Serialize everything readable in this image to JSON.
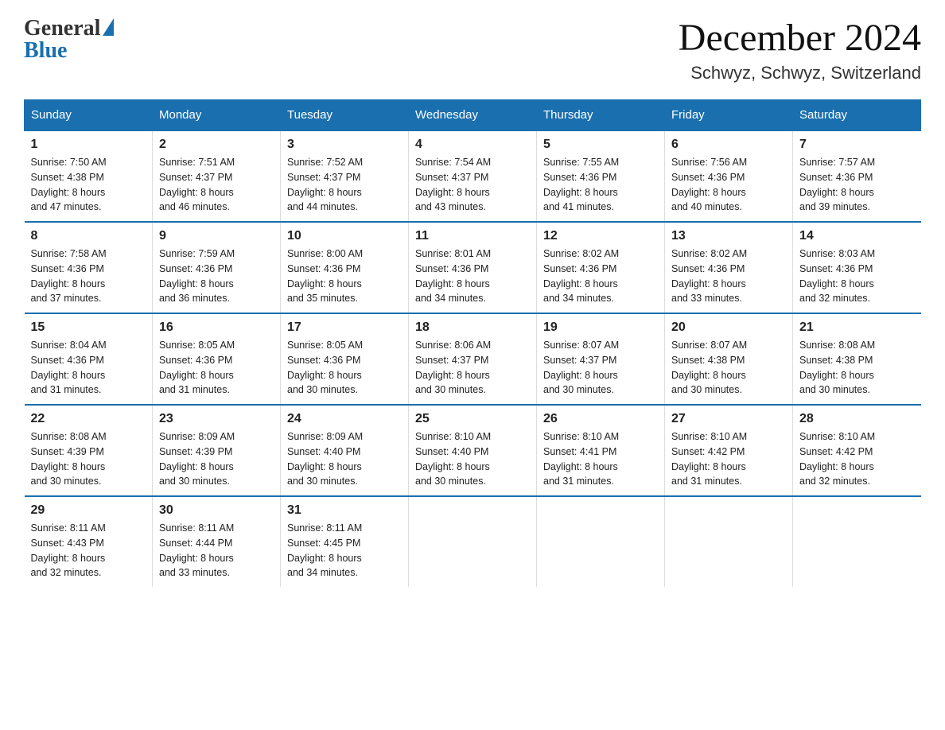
{
  "header": {
    "logo_general": "General",
    "logo_blue": "Blue",
    "month_title": "December 2024",
    "location": "Schwyz, Schwyz, Switzerland"
  },
  "days_of_week": [
    "Sunday",
    "Monday",
    "Tuesday",
    "Wednesday",
    "Thursday",
    "Friday",
    "Saturday"
  ],
  "weeks": [
    [
      {
        "day": "1",
        "sunrise": "7:50 AM",
        "sunset": "4:38 PM",
        "daylight": "8 hours and 47 minutes."
      },
      {
        "day": "2",
        "sunrise": "7:51 AM",
        "sunset": "4:37 PM",
        "daylight": "8 hours and 46 minutes."
      },
      {
        "day": "3",
        "sunrise": "7:52 AM",
        "sunset": "4:37 PM",
        "daylight": "8 hours and 44 minutes."
      },
      {
        "day": "4",
        "sunrise": "7:54 AM",
        "sunset": "4:37 PM",
        "daylight": "8 hours and 43 minutes."
      },
      {
        "day": "5",
        "sunrise": "7:55 AM",
        "sunset": "4:36 PM",
        "daylight": "8 hours and 41 minutes."
      },
      {
        "day": "6",
        "sunrise": "7:56 AM",
        "sunset": "4:36 PM",
        "daylight": "8 hours and 40 minutes."
      },
      {
        "day": "7",
        "sunrise": "7:57 AM",
        "sunset": "4:36 PM",
        "daylight": "8 hours and 39 minutes."
      }
    ],
    [
      {
        "day": "8",
        "sunrise": "7:58 AM",
        "sunset": "4:36 PM",
        "daylight": "8 hours and 37 minutes."
      },
      {
        "day": "9",
        "sunrise": "7:59 AM",
        "sunset": "4:36 PM",
        "daylight": "8 hours and 36 minutes."
      },
      {
        "day": "10",
        "sunrise": "8:00 AM",
        "sunset": "4:36 PM",
        "daylight": "8 hours and 35 minutes."
      },
      {
        "day": "11",
        "sunrise": "8:01 AM",
        "sunset": "4:36 PM",
        "daylight": "8 hours and 34 minutes."
      },
      {
        "day": "12",
        "sunrise": "8:02 AM",
        "sunset": "4:36 PM",
        "daylight": "8 hours and 34 minutes."
      },
      {
        "day": "13",
        "sunrise": "8:02 AM",
        "sunset": "4:36 PM",
        "daylight": "8 hours and 33 minutes."
      },
      {
        "day": "14",
        "sunrise": "8:03 AM",
        "sunset": "4:36 PM",
        "daylight": "8 hours and 32 minutes."
      }
    ],
    [
      {
        "day": "15",
        "sunrise": "8:04 AM",
        "sunset": "4:36 PM",
        "daylight": "8 hours and 31 minutes."
      },
      {
        "day": "16",
        "sunrise": "8:05 AM",
        "sunset": "4:36 PM",
        "daylight": "8 hours and 31 minutes."
      },
      {
        "day": "17",
        "sunrise": "8:05 AM",
        "sunset": "4:36 PM",
        "daylight": "8 hours and 30 minutes."
      },
      {
        "day": "18",
        "sunrise": "8:06 AM",
        "sunset": "4:37 PM",
        "daylight": "8 hours and 30 minutes."
      },
      {
        "day": "19",
        "sunrise": "8:07 AM",
        "sunset": "4:37 PM",
        "daylight": "8 hours and 30 minutes."
      },
      {
        "day": "20",
        "sunrise": "8:07 AM",
        "sunset": "4:38 PM",
        "daylight": "8 hours and 30 minutes."
      },
      {
        "day": "21",
        "sunrise": "8:08 AM",
        "sunset": "4:38 PM",
        "daylight": "8 hours and 30 minutes."
      }
    ],
    [
      {
        "day": "22",
        "sunrise": "8:08 AM",
        "sunset": "4:39 PM",
        "daylight": "8 hours and 30 minutes."
      },
      {
        "day": "23",
        "sunrise": "8:09 AM",
        "sunset": "4:39 PM",
        "daylight": "8 hours and 30 minutes."
      },
      {
        "day": "24",
        "sunrise": "8:09 AM",
        "sunset": "4:40 PM",
        "daylight": "8 hours and 30 minutes."
      },
      {
        "day": "25",
        "sunrise": "8:10 AM",
        "sunset": "4:40 PM",
        "daylight": "8 hours and 30 minutes."
      },
      {
        "day": "26",
        "sunrise": "8:10 AM",
        "sunset": "4:41 PM",
        "daylight": "8 hours and 31 minutes."
      },
      {
        "day": "27",
        "sunrise": "8:10 AM",
        "sunset": "4:42 PM",
        "daylight": "8 hours and 31 minutes."
      },
      {
        "day": "28",
        "sunrise": "8:10 AM",
        "sunset": "4:42 PM",
        "daylight": "8 hours and 32 minutes."
      }
    ],
    [
      {
        "day": "29",
        "sunrise": "8:11 AM",
        "sunset": "4:43 PM",
        "daylight": "8 hours and 32 minutes."
      },
      {
        "day": "30",
        "sunrise": "8:11 AM",
        "sunset": "4:44 PM",
        "daylight": "8 hours and 33 minutes."
      },
      {
        "day": "31",
        "sunrise": "8:11 AM",
        "sunset": "4:45 PM",
        "daylight": "8 hours and 34 minutes."
      },
      null,
      null,
      null,
      null
    ]
  ],
  "labels": {
    "sunrise": "Sunrise:",
    "sunset": "Sunset:",
    "daylight": "Daylight:"
  }
}
